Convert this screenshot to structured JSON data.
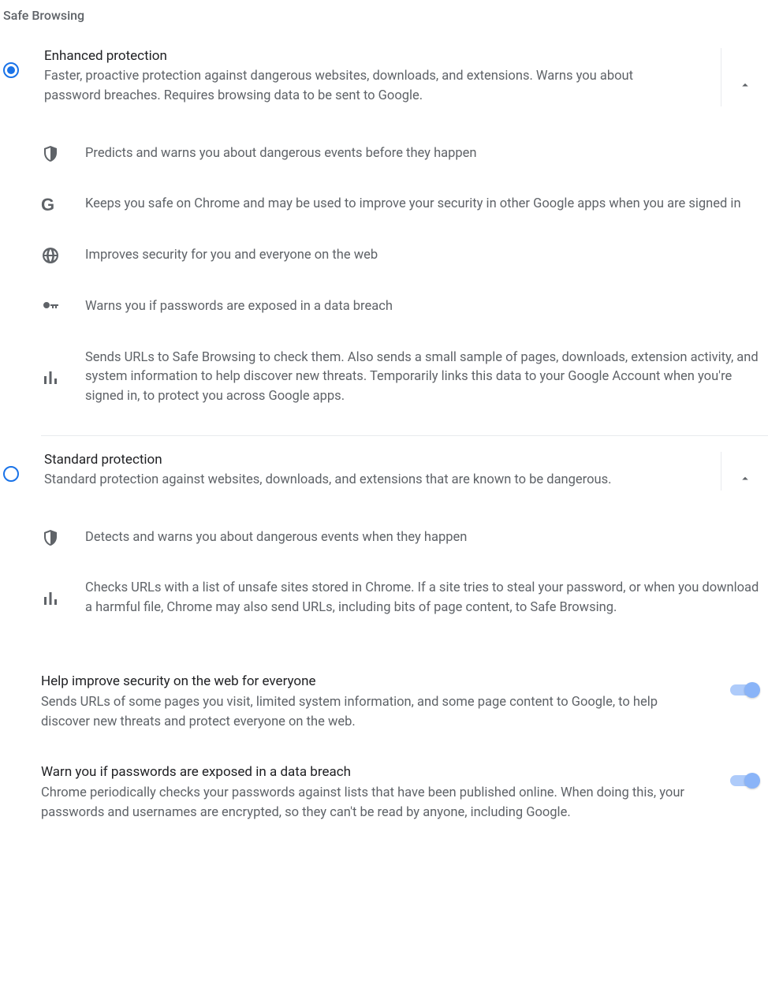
{
  "section": {
    "title": "Safe Browsing"
  },
  "options": {
    "enhanced": {
      "title": "Enhanced protection",
      "desc": "Faster, proactive protection against dangerous websites, downloads, and extensions. Warns you about password breaches. Requires browsing data to be sent to Google.",
      "selected": true,
      "expanded": true,
      "features": {
        "f0": "Predicts and warns you about dangerous events before they happen",
        "f1": "Keeps you safe on Chrome and may be used to improve your security in other Google apps when you are signed in",
        "f2": "Improves security for you and everyone on the web",
        "f3": "Warns you if passwords are exposed in a data breach",
        "f4": "Sends URLs to Safe Browsing to check them. Also sends a small sample of pages, downloads, extension activity, and system information to help discover new threats. Temporarily links this data to your Google Account when you're signed in, to protect you across Google apps."
      }
    },
    "standard": {
      "title": "Standard protection",
      "desc": "Standard protection against websites, downloads, and extensions that are known to be dangerous.",
      "selected": false,
      "expanded": true,
      "features": {
        "f0": "Detects and warns you about dangerous events when they happen",
        "f1": "Checks URLs with a list of unsafe sites stored in Chrome. If a site tries to steal your password, or when you download a harmful file, Chrome may also send URLs, including bits of page content, to Safe Browsing."
      },
      "subs": {
        "improve": {
          "title": "Help improve security on the web for everyone",
          "desc": "Sends URLs of some pages you visit, limited system information, and some page content to Google, to help discover new threats and protect everyone on the web.",
          "on": true
        },
        "passwords": {
          "title": "Warn you if passwords are exposed in a data breach",
          "desc": "Chrome periodically checks your passwords against lists that have been published online. When doing this, your passwords and usernames are encrypted, so they can't be read by anyone, including Google.",
          "on": true
        }
      }
    }
  }
}
